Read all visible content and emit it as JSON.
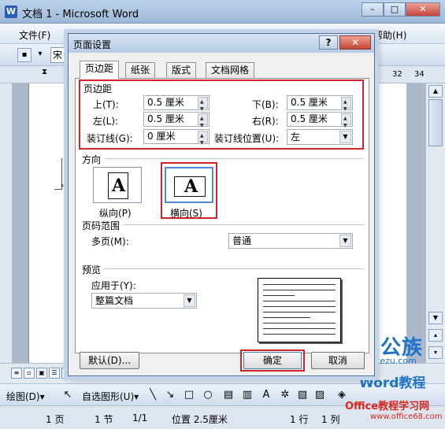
{
  "window": {
    "title": "文档 1 - Microsoft Word",
    "controls": {
      "minimize": "–",
      "maximize": "□",
      "close": "✕"
    }
  },
  "menubar": {
    "items": [
      {
        "label": "文件(F)"
      },
      {
        "label": "帮助(H)"
      }
    ]
  },
  "toolbar": {
    "font_name": "宋"
  },
  "ruler": {
    "ticks": [
      "32",
      "34"
    ]
  },
  "dialog": {
    "title": "页面设置",
    "help": "?",
    "close": "✕",
    "tabs": [
      {
        "label": "页边距",
        "active": true
      },
      {
        "label": "纸张",
        "active": false
      },
      {
        "label": "版式",
        "active": false
      },
      {
        "label": "文档网格",
        "active": false
      }
    ],
    "margins": {
      "section_label": "页边距",
      "top_label": "上(T):",
      "top_value": "0.5 厘米",
      "bottom_label": "下(B):",
      "bottom_value": "0.5 厘米",
      "left_label": "左(L):",
      "left_value": "0.5 厘米",
      "right_label": "右(R):",
      "right_value": "0.5 厘米",
      "gutter_label": "装订线(G):",
      "gutter_value": "0 厘米",
      "gutter_pos_label": "装订线位置(U):",
      "gutter_pos_value": "左"
    },
    "orientation": {
      "section_label": "方向",
      "glyph": "A",
      "portrait_label": "纵向(P)",
      "landscape_label": "横向(S)",
      "selected": "landscape"
    },
    "pages": {
      "section_label": "页码范围",
      "multiple_label": "多页(M):",
      "multiple_value": "普通"
    },
    "preview": {
      "section_label": "预览",
      "apply_label": "应用于(Y):",
      "apply_value": "整篇文档"
    },
    "buttons": {
      "default": "默认(D)...",
      "ok": "确定",
      "cancel": "取消"
    }
  },
  "statusbar": {
    "page": "1 页",
    "section": "1 节",
    "page_of": "1/1",
    "position": "位置 2.5厘米",
    "line": "1 行",
    "column": "1 列"
  },
  "drawbar": {
    "draw_label": "绘图(D)▾",
    "autoshapes_label": "自选图形(U)▾"
  },
  "watermark": {
    "logo": "办公族",
    "url": "Officezu.com",
    "word": "Word教程",
    "site": "Office教程学习网",
    "site_url": "www.office68.com"
  },
  "colors": {
    "highlight_red": "#d0242a",
    "accent_blue": "#1f74c9"
  }
}
